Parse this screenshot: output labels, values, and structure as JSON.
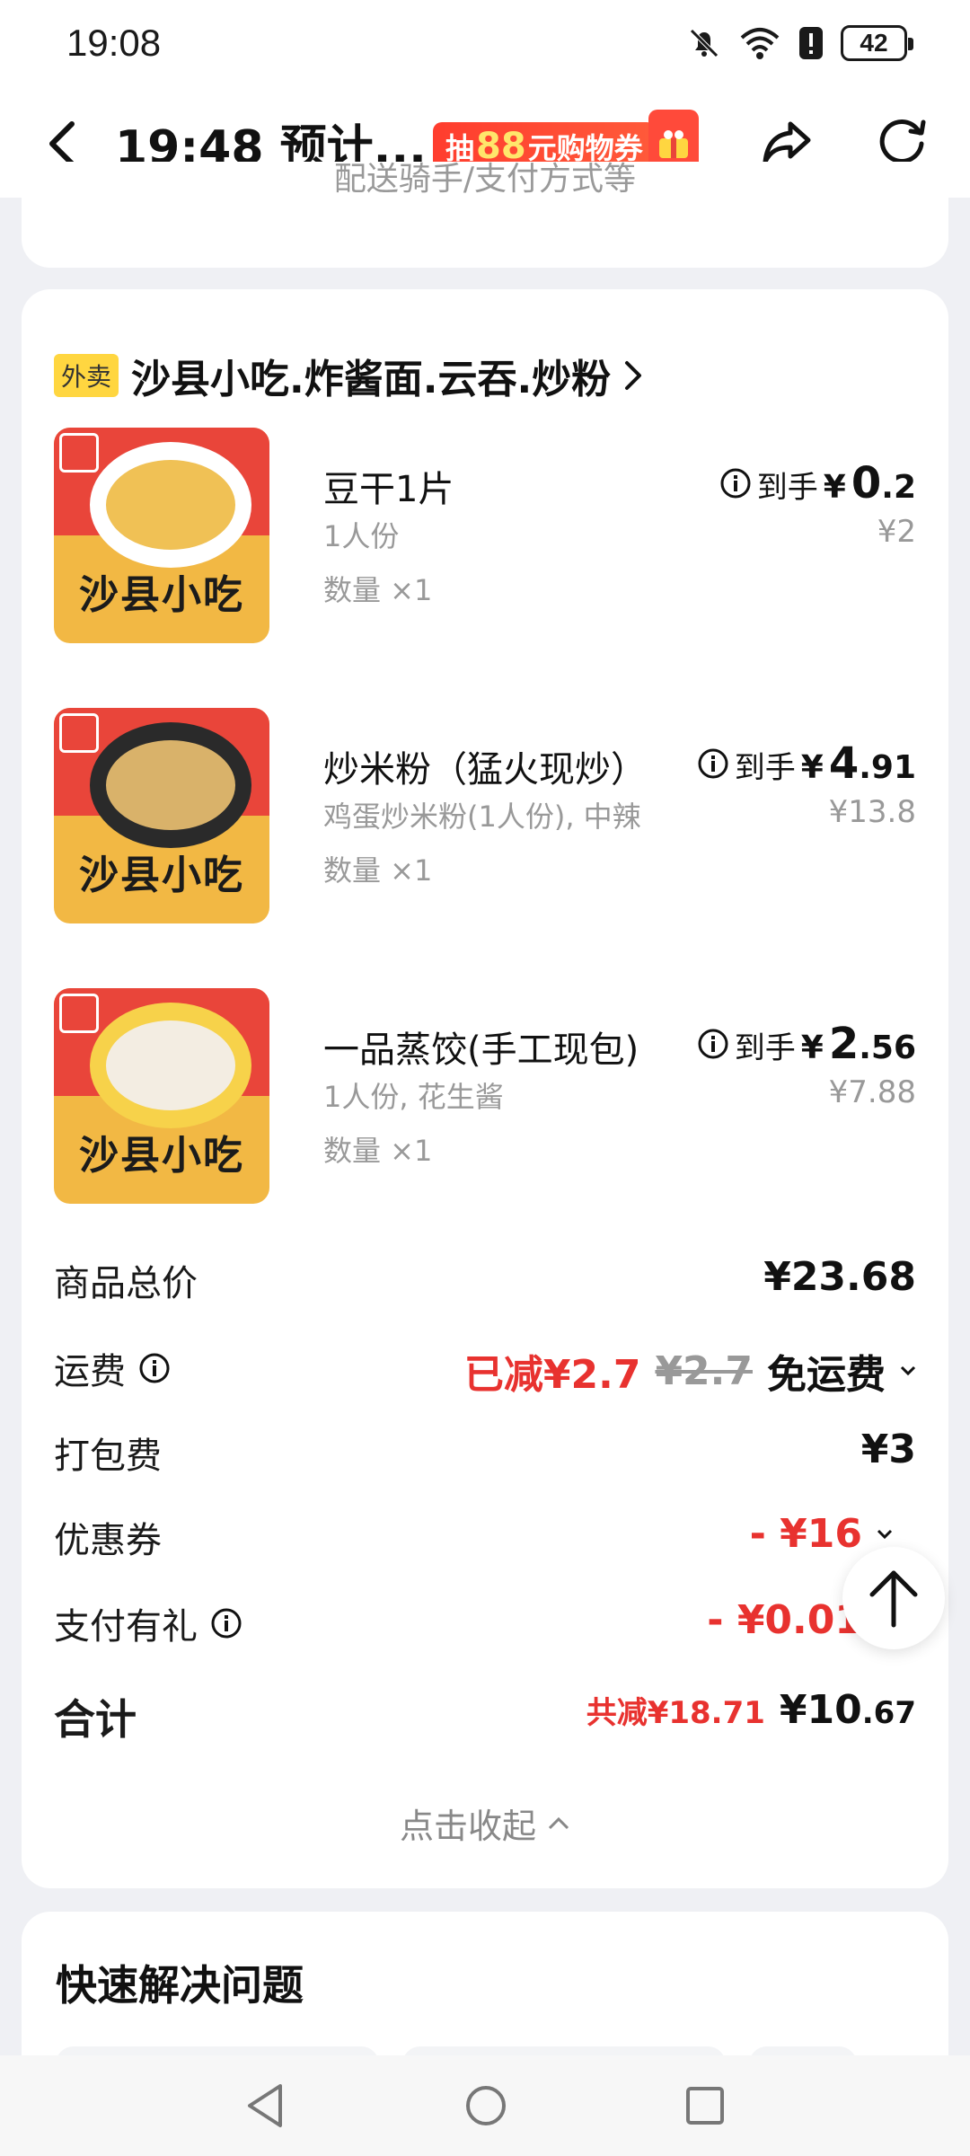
{
  "status_bar": {
    "time": "19:08",
    "battery": "42"
  },
  "header": {
    "title": "19:48 预计...",
    "promo_prefix": "抽",
    "promo_amount": "88",
    "promo_suffix": "元购物券"
  },
  "top_card": {
    "cut_text": "配送骑手/支付方式等"
  },
  "shop": {
    "tag": "外卖",
    "name": "沙县小吃.炸酱面.云吞.炒粉"
  },
  "items": [
    {
      "name": "豆干1片",
      "spec": "1人份",
      "qty": "数量 ×1",
      "price_label": "到手",
      "yen": "¥",
      "price_int": "0",
      "price_dec": ".2",
      "original": "¥2"
    },
    {
      "name": "炒米粉（猛火现炒）",
      "spec": "鸡蛋炒米粉(1人份), 中辣",
      "qty": "数量 ×1",
      "price_label": "到手",
      "yen": "¥",
      "price_int": "4",
      "price_dec": ".91",
      "original": "¥13.8"
    },
    {
      "name": "一品蒸饺(手工现包)",
      "spec": "1人份, 花生酱",
      "qty": "数量 ×1",
      "price_label": "到手",
      "yen": "¥",
      "price_int": "2",
      "price_dec": ".56",
      "original": "¥7.88"
    }
  ],
  "thumb_logo": "沙县小吃",
  "summary": {
    "goods_total_label": "商品总价",
    "goods_total": "¥23.68",
    "delivery_label": "运费",
    "delivery_reduced": "已减¥2.7",
    "delivery_original": "¥2.7",
    "delivery_value": "免运费",
    "packing_label": "打包费",
    "packing_value": "¥3",
    "coupon_label": "优惠券",
    "coupon_value": "- ¥16",
    "paygift_label": "支付有礼",
    "paygift_value": "- ¥0.01",
    "total_label": "合计",
    "total_saved": "共减¥18.71",
    "total_yen": "¥",
    "total_int": "10",
    "total_dec": ".67"
  },
  "collapse_label": "点击收起",
  "quick": {
    "title": "快速解决问题"
  },
  "colors": {
    "accent_red": "#e8322f",
    "tag_yellow": "#ffd640",
    "promo_red": "#ff3d2e"
  }
}
